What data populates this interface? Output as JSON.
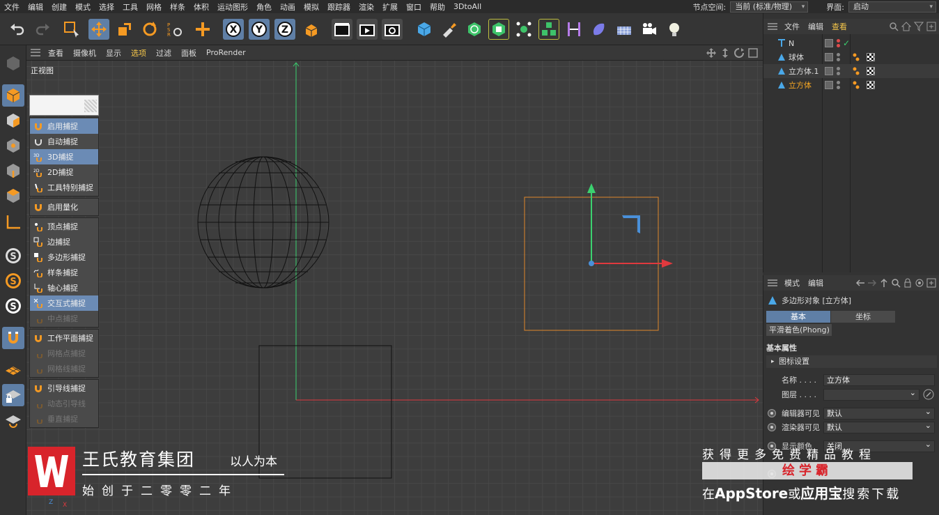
{
  "menubar": {
    "items": [
      "文件",
      "编辑",
      "创建",
      "模式",
      "选择",
      "工具",
      "网格",
      "样条",
      "体积",
      "运动图形",
      "角色",
      "动画",
      "模拟",
      "跟踪器",
      "渲染",
      "扩展",
      "窗口",
      "帮助",
      "3DtoAll"
    ],
    "node_space_label": "节点空间:",
    "node_space_value": "当前 (标准/物理)",
    "layout_label": "界面:",
    "layout_value": "启动"
  },
  "toolbar": {
    "tools": [
      "undo-icon",
      "redo-icon",
      "live-select-icon",
      "move-icon",
      "scale-icon",
      "rotate-icon",
      "psr-icon",
      "plus-move-icon",
      "x-axis-icon",
      "y-axis-icon",
      "z-axis-icon",
      "coord-system-icon",
      "render-view-icon",
      "render-picture-viewer-icon",
      "render-settings-icon",
      "cube-icon",
      "pen-icon",
      "subdivision-icon",
      "extrude-icon",
      "cloner-icon",
      "mograph-icon",
      "bend-icon",
      "deformer-icon",
      "floor-icon",
      "camera-icon",
      "light-icon"
    ]
  },
  "viewport": {
    "menu": [
      "查看",
      "摄像机",
      "显示",
      "选项",
      "过滤",
      "面板",
      "ProRender"
    ],
    "label": "正视图"
  },
  "snap_menu": {
    "groups": [
      [
        {
          "label": "启用捕捉",
          "state": "hl"
        },
        {
          "label": "自动捕捉",
          "state": ""
        },
        {
          "label": "3D捕捉",
          "state": "hl"
        },
        {
          "label": "2D捕捉",
          "state": ""
        },
        {
          "label": "工具特别捕捉",
          "state": ""
        }
      ],
      [
        {
          "label": "启用量化",
          "state": ""
        }
      ],
      [
        {
          "label": "顶点捕捉",
          "state": ""
        },
        {
          "label": "边捕捉",
          "state": ""
        },
        {
          "label": "多边形捕捉",
          "state": ""
        },
        {
          "label": "样条捕捉",
          "state": ""
        },
        {
          "label": "轴心捕捉",
          "state": ""
        },
        {
          "label": "交互式捕捉",
          "state": "hl"
        },
        {
          "label": "中点捕捉",
          "state": "dis"
        }
      ],
      [
        {
          "label": "工作平面捕捉",
          "state": ""
        },
        {
          "label": "网格点捕捉",
          "state": "dis"
        },
        {
          "label": "网格线捕捉",
          "state": "dis"
        }
      ],
      [
        {
          "label": "引导线捕捉",
          "state": ""
        },
        {
          "label": "动态引导线",
          "state": "dis"
        },
        {
          "label": "垂直捕捉",
          "state": "dis"
        }
      ]
    ]
  },
  "object_manager": {
    "menu": [
      "文件",
      "编辑",
      "查看"
    ],
    "objects": [
      {
        "name": "N",
        "active": false
      },
      {
        "name": "球体",
        "active": false
      },
      {
        "name": "立方体.1",
        "active": false
      },
      {
        "name": "立方体",
        "active": true
      }
    ]
  },
  "attribute_manager": {
    "menu": [
      "模式",
      "编辑"
    ],
    "title": "多边形对象 [立方体]",
    "tabs": [
      "基本",
      "坐标"
    ],
    "tab2": "平滑着色(Phong)",
    "section": "基本属性",
    "subsection": "图标设置",
    "fields": {
      "name_label": "名称 . . . .",
      "name_value": "立方体",
      "layer_label": "图层 . . . .",
      "layer_value": "",
      "editor_visible_label": "编辑器可见",
      "editor_visible_value": "默认",
      "render_visible_label": "渲染器可见",
      "render_visible_value": "默认",
      "display_color_label": "显示颜色",
      "display_color_value": "关闭"
    }
  },
  "watermark": {
    "title": "王氏教育集团",
    "slogan": "以人为本",
    "subtitle": "始创于二零零二年",
    "right_line1": "获得更多免费精品教程",
    "right_line2": "绘学霸",
    "right_line3_a": "在",
    "right_line3_b": "AppStore",
    "right_line3_c": "或",
    "right_line3_d": "应用宝",
    "right_line3_e": "搜索下载"
  },
  "colors": {
    "accent_blue": "#5f7fa6",
    "active_object": "#f5a623",
    "axis_x": "#e0393e",
    "axis_y": "#3bd16f",
    "brand_red": "#d8242b"
  }
}
